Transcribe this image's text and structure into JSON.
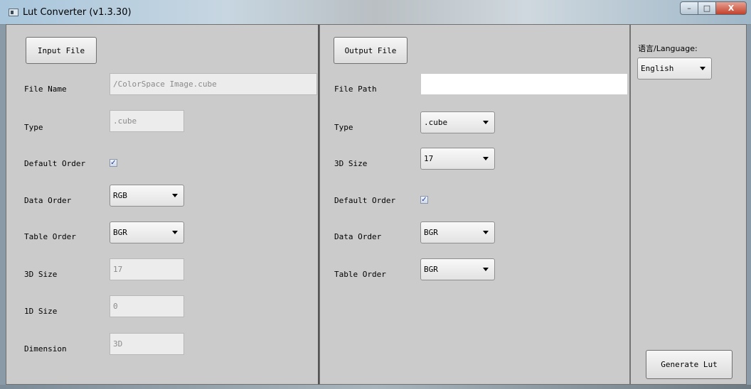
{
  "window": {
    "title": "Lut Converter (v1.3.30)",
    "buttons": {
      "minimize": "–",
      "maximize": "□",
      "close": "X"
    }
  },
  "input": {
    "button_label": "Input File",
    "file_name_label": "File Name",
    "file_name_value": "/ColorSpace Image.cube",
    "type_label": "Type",
    "type_value": ".cube",
    "default_order_label": "Default Order",
    "default_order_checked": true,
    "data_order_label": "Data Order",
    "data_order_value": "RGB",
    "table_order_label": "Table Order",
    "table_order_value": "BGR",
    "size3d_label": "3D Size",
    "size3d_value": "17",
    "size1d_label": "1D Size",
    "size1d_value": "0",
    "dimension_label": "Dimension",
    "dimension_value": "3D"
  },
  "output": {
    "button_label": "Output File",
    "file_path_label": "File Path",
    "file_path_value": "",
    "type_label": "Type",
    "type_value": ".cube",
    "size3d_label": "3D Size",
    "size3d_value": "17",
    "default_order_label": "Default Order",
    "default_order_checked": true,
    "data_order_label": "Data Order",
    "data_order_value": "BGR",
    "table_order_label": "Table Order",
    "table_order_value": "BGR"
  },
  "language": {
    "label": "语言/Language:",
    "value": "English"
  },
  "actions": {
    "generate_label": "Generate Lut"
  },
  "check_mark": "✓"
}
